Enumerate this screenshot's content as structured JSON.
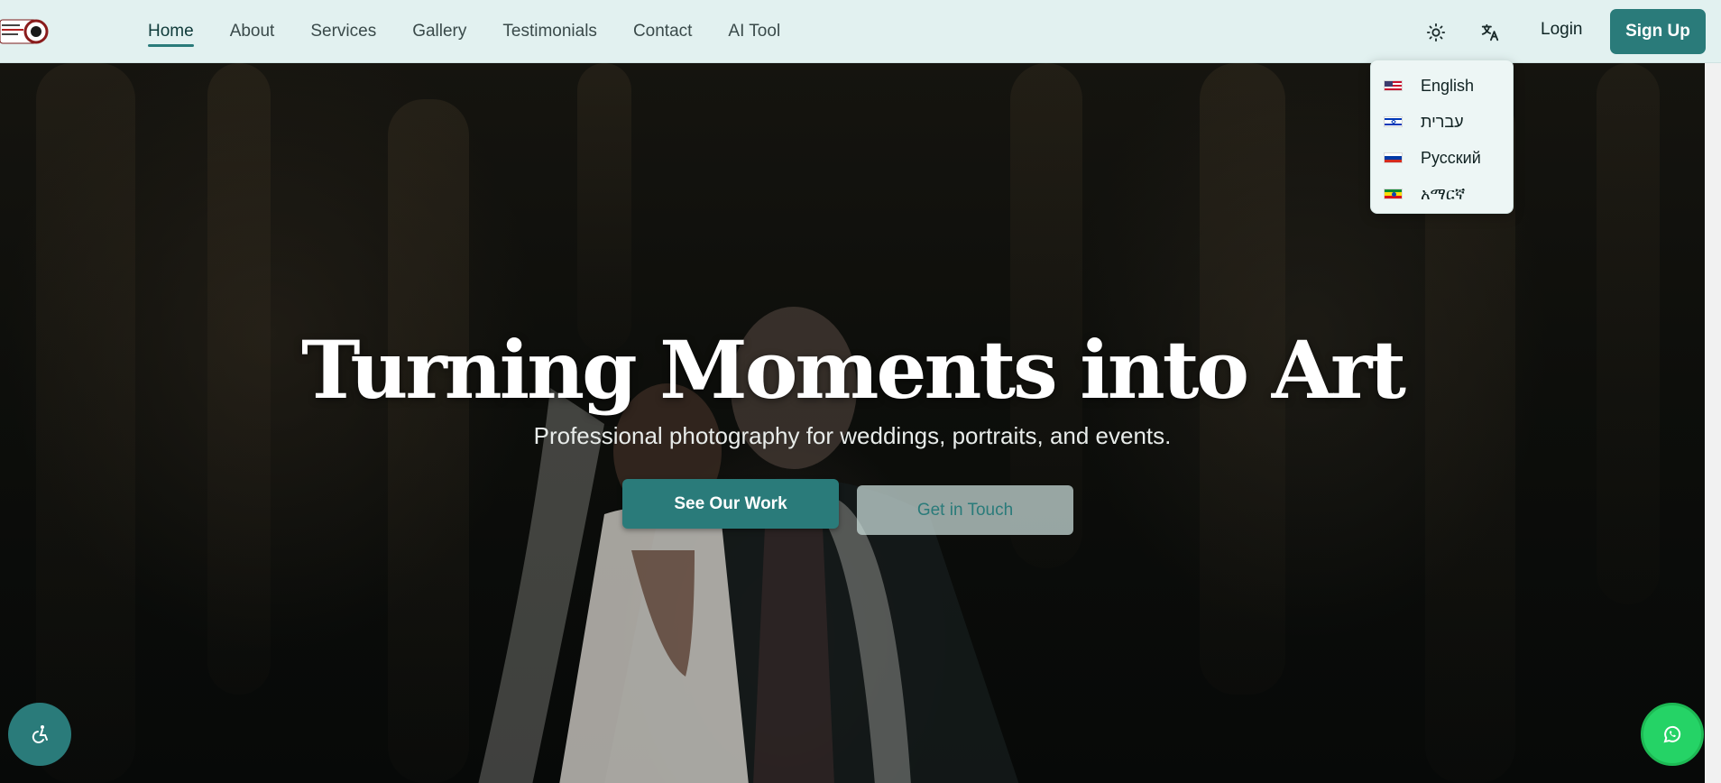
{
  "brand": {
    "logo_icon": "camera-logo",
    "accent": "#2a7b7a"
  },
  "nav": {
    "items": [
      {
        "label": "Home",
        "active": true
      },
      {
        "label": "About"
      },
      {
        "label": "Services"
      },
      {
        "label": "Gallery"
      },
      {
        "label": "Testimonials"
      },
      {
        "label": "Contact"
      },
      {
        "label": "AI Tool"
      }
    ]
  },
  "header": {
    "theme_icon": "sun-icon",
    "language_icon": "translate-icon",
    "login_label": "Login",
    "signup_label": "Sign Up"
  },
  "language_menu": {
    "items": [
      {
        "label": "English",
        "flag": "us-flag-icon"
      },
      {
        "label": "עברית",
        "flag": "israel-flag-icon"
      },
      {
        "label": "Русский",
        "flag": "russia-flag-icon"
      },
      {
        "label": "አማርኛ",
        "flag": "ethiopia-flag-icon"
      }
    ]
  },
  "hero": {
    "title": "Turning Moments into Art",
    "subtitle": "Professional photography for weddings, portraits, and events.",
    "primary_cta": "See Our Work",
    "secondary_cta": "Get in Touch"
  },
  "floating": {
    "accessibility_icon": "accessibility-icon",
    "whatsapp_icon": "whatsapp-icon",
    "whatsapp_color": "#25d366"
  }
}
